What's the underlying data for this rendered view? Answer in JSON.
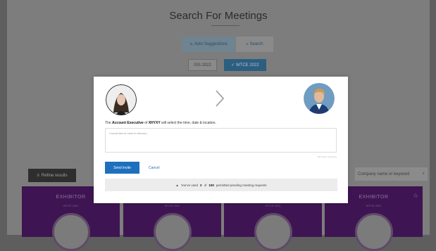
{
  "page": {
    "title": "Search For Meetings",
    "toggle": {
      "auto_label": "Auto Suggestions",
      "search_label": "Search"
    },
    "events": [
      {
        "label": "ISS 2022"
      },
      {
        "label": "WTCE 2022"
      }
    ],
    "refine_label": "Refine results",
    "keyword_placeholder": "Company name or keyword",
    "cards": [
      {
        "type": "EXHIBITOR",
        "event": "WTCE 2022"
      },
      {
        "type": "",
        "event": "WTCE 2022"
      },
      {
        "type": "",
        "event": "WTCE 2022"
      },
      {
        "type": "EXHIBITOR",
        "event": "WTCE 2022"
      }
    ]
  },
  "modal": {
    "intro_prefix": "The",
    "role": "Account Executive",
    "intro_mid": "of",
    "company": "XHYXY",
    "intro_suffix": "will select the time, date & location.",
    "message_placeholder": "I would like to meet to discuss...",
    "char_count": "500 chars remaining",
    "send_label": "Send invite",
    "cancel_label": "Cancel",
    "info_prefix": "You've used",
    "used": "2",
    "info_mid": "of",
    "limit": "100",
    "info_suffix": "permitted pending meeting requests"
  },
  "colors": {
    "primary": "#1f6fbe",
    "card_purple": "#3e1552",
    "overlay": "#5e5e5e"
  }
}
